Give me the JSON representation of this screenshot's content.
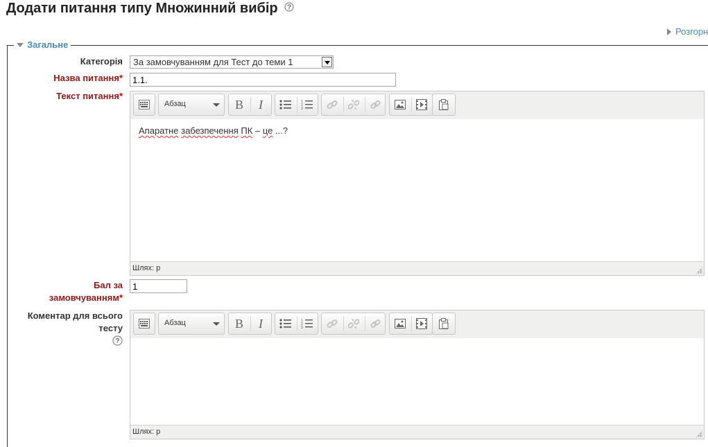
{
  "page": {
    "title": "Додати питання типу Множинний вибір",
    "expand_link": "Розгорн"
  },
  "section": {
    "legend": "Загальне"
  },
  "form": {
    "category": {
      "label": "Категорія",
      "selected": "За замовчуванням для Тест до теми 1"
    },
    "question_name": {
      "label": "Назва питання",
      "value": "1.1."
    },
    "question_text": {
      "label": "Текст питання",
      "content_parts": [
        "Апаратне",
        " ",
        "забезпечення",
        " ",
        "ПК",
        " – ",
        "це",
        " ...?"
      ],
      "path": "Шлях: p"
    },
    "default_mark": {
      "label_line1": "Бал за",
      "label_line2": "замовчуванням",
      "value": "1"
    },
    "general_feedback": {
      "label_line1": "Коментар для всього",
      "label_line2": "тесту",
      "path": "Шлях: p"
    },
    "required_star": "*"
  },
  "editor_toolbar": {
    "format_label": "Абзац",
    "buttons": [
      "toggle-toolbar-icon",
      "bold-icon",
      "italic-icon",
      "bullet-list-icon",
      "numbered-list-icon",
      "link-icon",
      "unlink-icon",
      "anchor-icon",
      "image-icon",
      "media-icon",
      "paste-icon"
    ]
  },
  "colors": {
    "accent": "#4a8ab5",
    "required_label": "#8b1a1a",
    "required_star": "#cc0000"
  }
}
